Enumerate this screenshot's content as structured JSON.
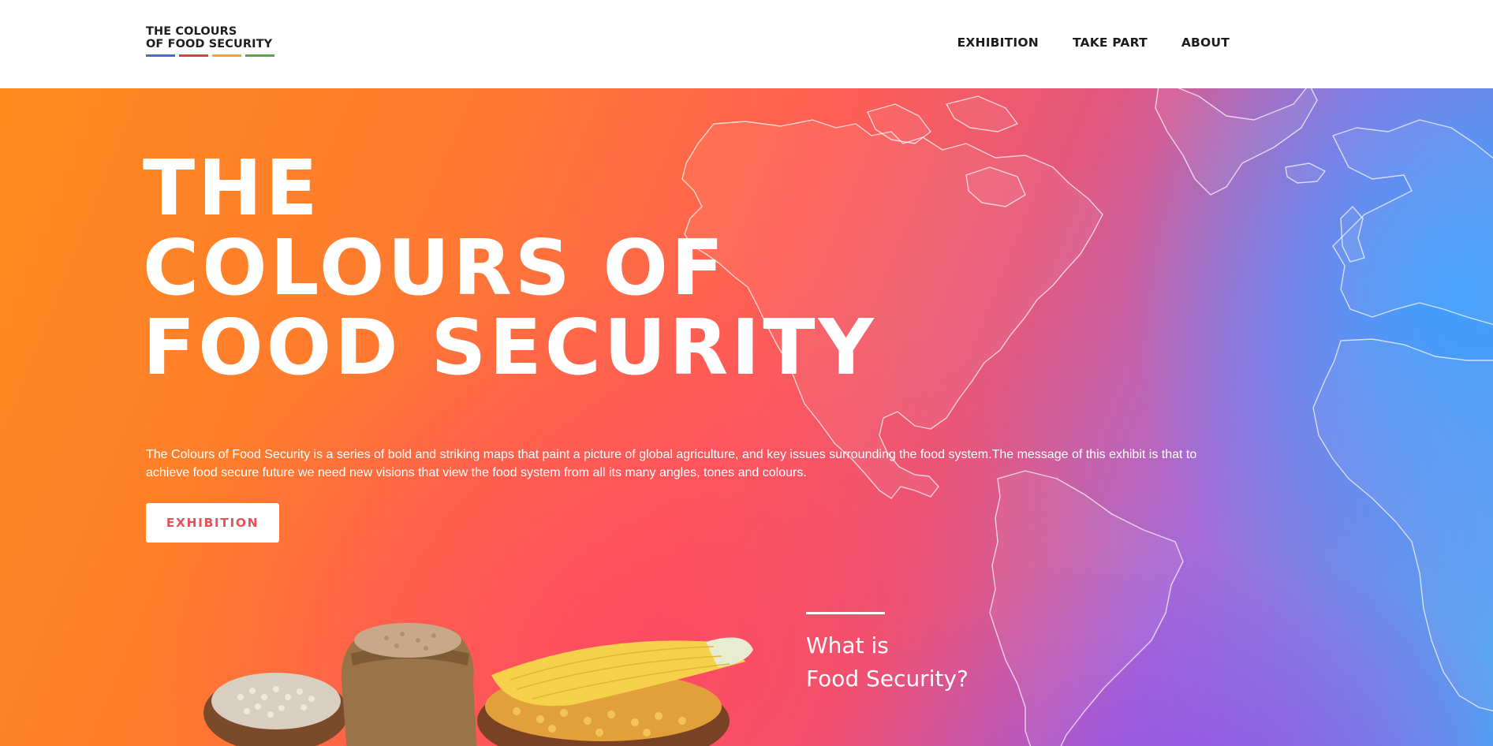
{
  "header": {
    "logo": {
      "line1": "THE COLOURS",
      "line2": "OF FOOD SECURITY",
      "stripe_colors": [
        "#3f6fc6",
        "#d9423b",
        "#f0a23c",
        "#5aa646"
      ]
    },
    "nav": [
      {
        "label": "EXHIBITION"
      },
      {
        "label": "TAKE PART"
      },
      {
        "label": "ABOUT"
      }
    ]
  },
  "hero": {
    "title_lines": [
      "THE",
      "COLOURS OF",
      "FOOD SECURITY"
    ],
    "description": "The Colours of Food Security is a series of bold and striking maps that paint a picture of global agriculture, and key issues surrounding the food system.The message of this exhibit is that to achieve food secure future we need new visions that view the food system from all its many angles, tones and colours.",
    "button_label": "EXHIBITION",
    "what_is": {
      "line1": "What is",
      "line2": "Food Security?"
    }
  },
  "colors": {
    "accent": "#e8505b",
    "gradient_orange": "#ff8a1c",
    "gradient_pink": "#ff5f55",
    "gradient_purple": "#a76ad6",
    "gradient_blue": "#4aa8f5"
  }
}
